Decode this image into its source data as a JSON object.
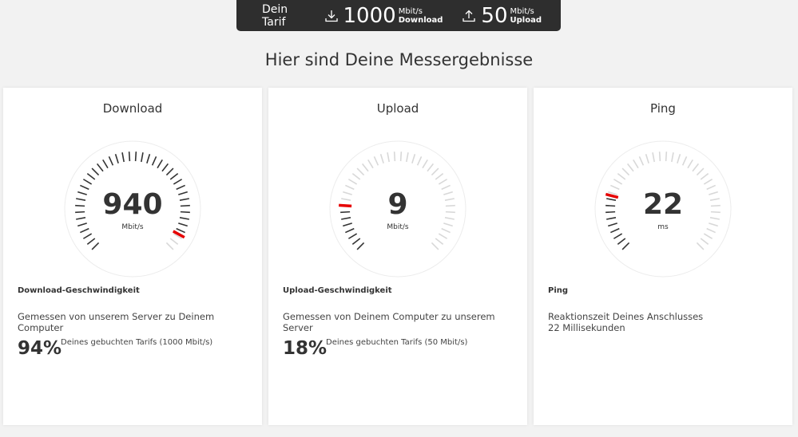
{
  "tariff": {
    "label": "Dein Tarif",
    "download": {
      "value": "1000",
      "unit": "Mbit/s",
      "type": "Download"
    },
    "upload": {
      "value": "50",
      "unit": "Mbit/s",
      "type": "Upload"
    }
  },
  "title": "Hier sind Deine Messergebnisse",
  "cards": {
    "download": {
      "title": "Download",
      "value": "940",
      "unit": "Mbit/s",
      "fraction": 0.94,
      "heading": "Download-Geschwindigkeit",
      "description": "Gemessen von unserem Server zu Deinem Computer",
      "percent": "94%",
      "percent_note": "Deines gebuchten Tarifs (1000 Mbit/s)"
    },
    "upload": {
      "title": "Upload",
      "value": "9",
      "unit": "Mbit/s",
      "fraction": 0.18,
      "heading": "Upload-Geschwindigkeit",
      "description": "Gemessen von Deinem Computer zu unserem Server",
      "percent": "18%",
      "percent_note": "Deines gebuchten Tarifs (50 Mbit/s)"
    },
    "ping": {
      "title": "Ping",
      "value": "22",
      "unit": "ms",
      "fraction": 0.22,
      "heading": "Ping",
      "description_line1": "Reaktionszeit Deines Anschlusses",
      "description_line2": "22 Millisekunden"
    }
  },
  "colors": {
    "accent": "#e60000",
    "tick_active": "#333333",
    "tick_inactive": "#d8d8d8",
    "bar": "#2e2e2e"
  }
}
